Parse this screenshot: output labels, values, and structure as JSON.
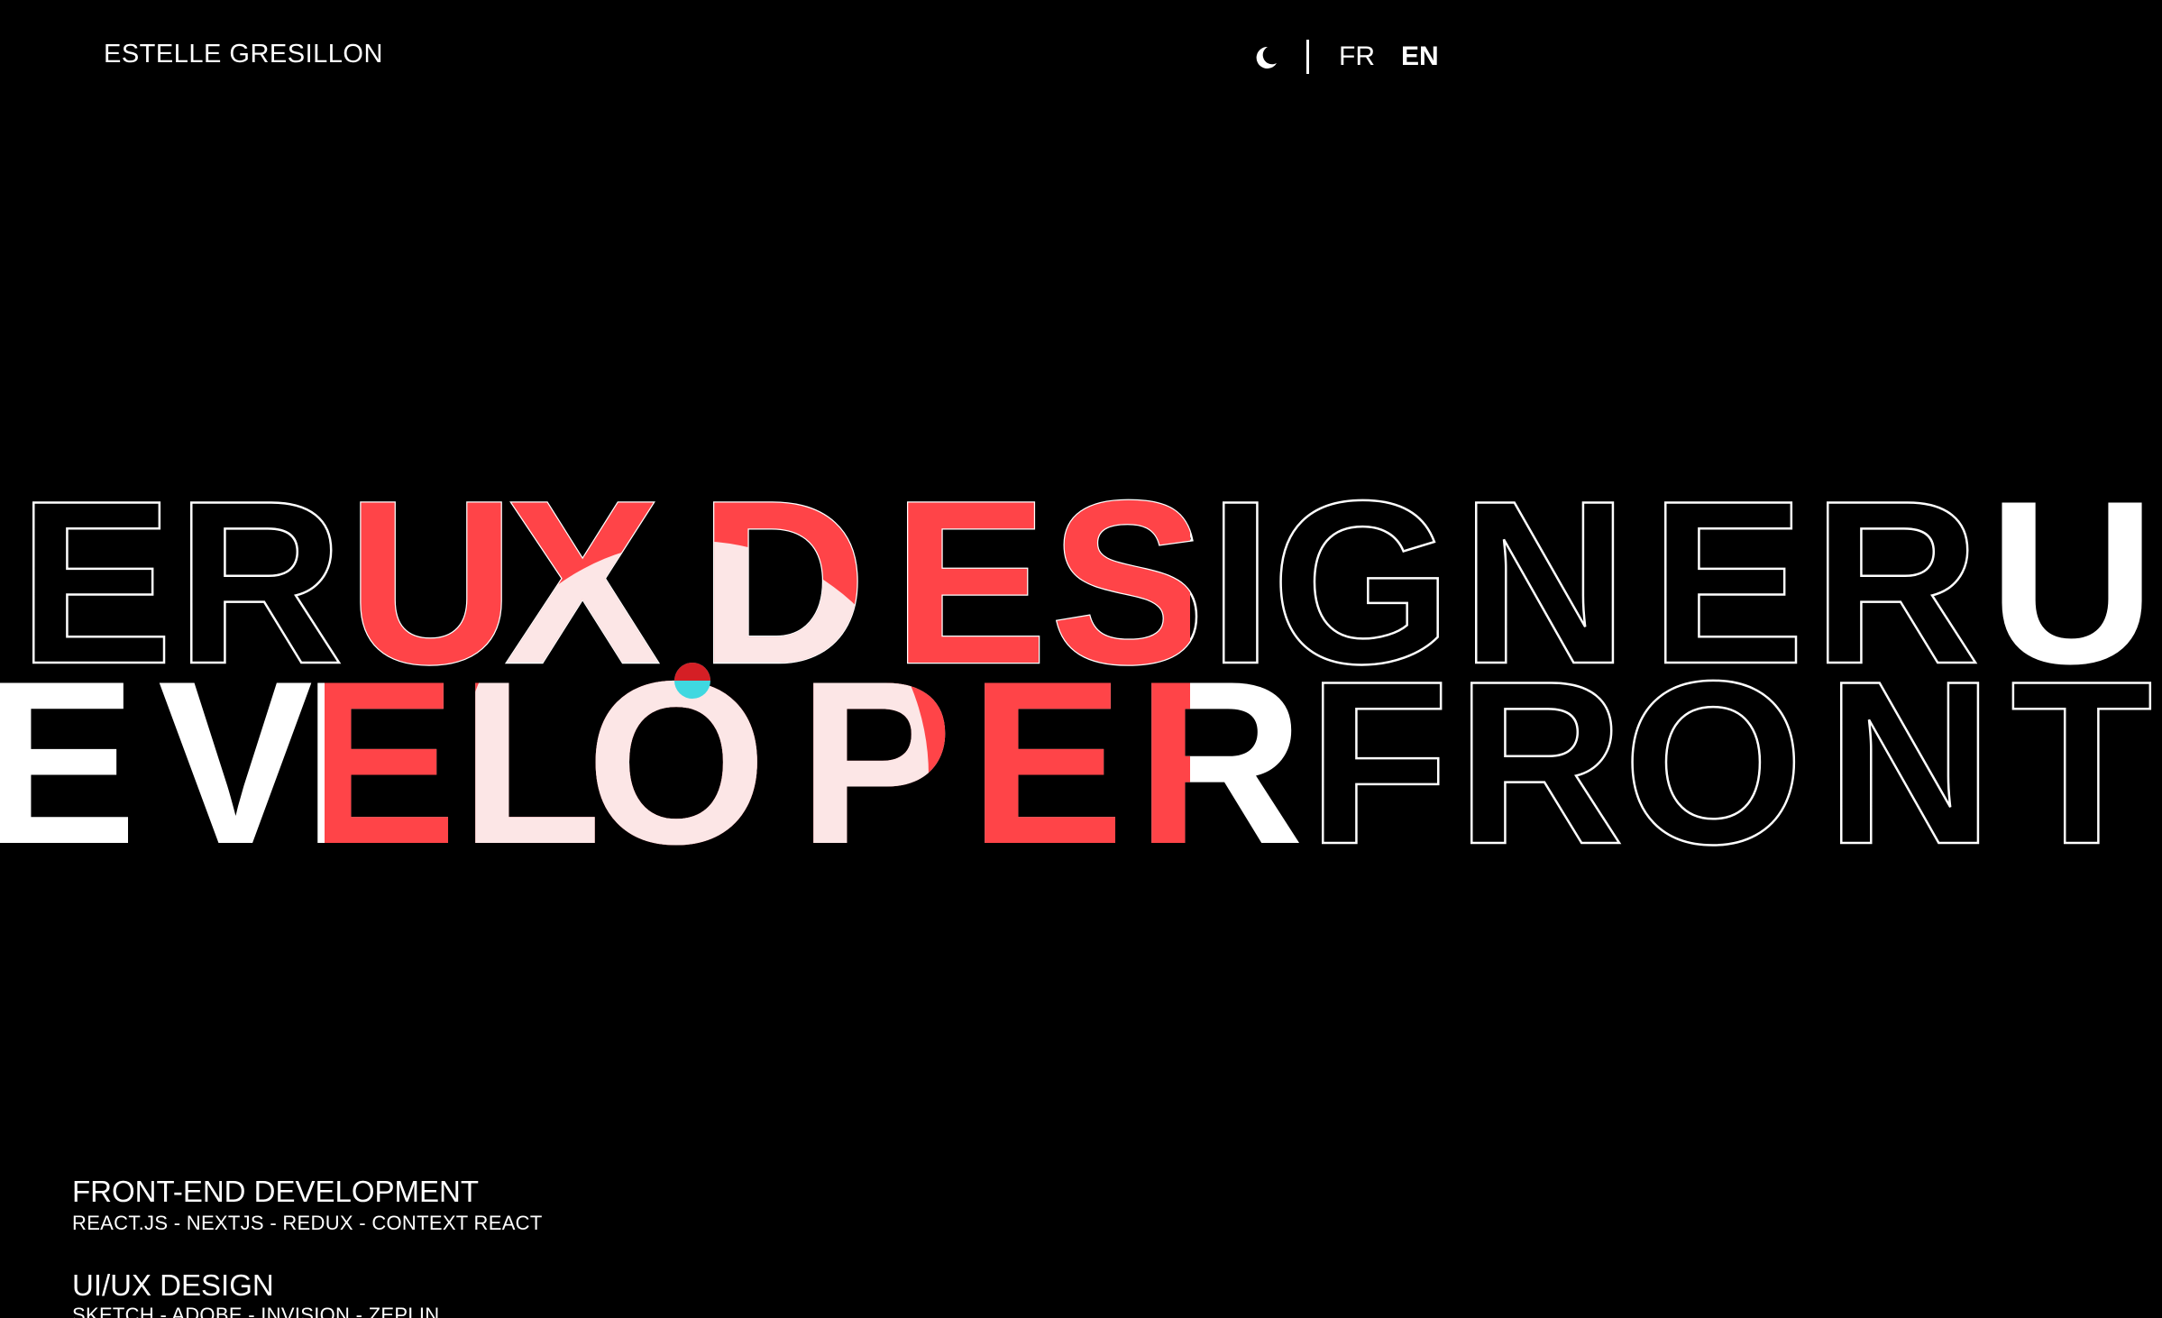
{
  "header": {
    "logo": "ESTELLE GRESILLON",
    "theme_icon": "moon-icon",
    "lang_fr": "FR",
    "lang_en": "EN",
    "active_lang": "EN"
  },
  "hero": {
    "line1": [
      "E",
      "R",
      "U",
      "X",
      "D",
      "E",
      "S",
      "I",
      "G",
      "N",
      "E",
      "R",
      "U"
    ],
    "line2": [
      "E",
      "V",
      "E",
      "L",
      "O",
      "P",
      "E",
      "R",
      "F",
      "R",
      "O",
      "N",
      "T"
    ]
  },
  "skills": [
    {
      "title": "FRONT-END DEVELOPMENT",
      "tools": "REACT.JS - NEXTJS - REDUX - CONTEXT REACT"
    },
    {
      "title": "UI/UX DESIGN",
      "tools": "SKETCH - ADOBE - INVISION - ZEPLIN"
    }
  ],
  "colors": {
    "background": "#000000",
    "accent_red": "#ff4448",
    "accent_pink": "#fce6e6",
    "accent_cyan": "#3fd8e0",
    "text": "#ffffff"
  }
}
